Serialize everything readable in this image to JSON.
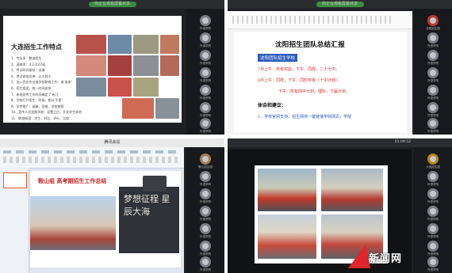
{
  "q1": {
    "title": "你正在观看屏幕共享",
    "slide_title": "大连招生工作特点",
    "points": [
      "1、专业多：数或招生",
      "2、录取率：4.2-4.07高",
      "3、考试时间紧张：选课",
      "4、考试参加名单：从大到小",
      "5、加入优化专业或学校联络工作：或'谁来'",
      "6、招生组团，统一时间安排",
      "7、参加宣传工作时间确定了'有几'",
      "8、学校打开招生，时候，都计'不是'",
      "9、宣传推广：或精，宣推、学校推荐",
      "10、宣传人员宣推学校：设置之后，开发学生体验",
      "11、联谊新团：学生、对比、评价、比较"
    ]
  },
  "q2": {
    "title": "你正在观看屏幕共享",
    "doc_heading": "沈阳招生团队总结汇报",
    "group_label": "沈阳团队招生学校",
    "lines": [
      "7月上午：所有实验，下午：同样，二十七中。",
      "8月上午：同样，下午：同时学校（十中计划）。",
      "下午：所有四中计划，理科，下届计划。",
      "体会和建议：",
      "1、学校官网支持，招生网将一键链接学院网页，学院"
    ]
  },
  "q3": {
    "title": "腾讯会议",
    "slide_title": "鞍山组 高考期招生工作总结",
    "banner_text": "梦想征程 星辰大海"
  },
  "q4": {
    "title": "",
    "watermark": "新闻网"
  },
  "side_q1": [
    "外语学院",
    "外语学院",
    "外语学院",
    "外语学院",
    "外语学院",
    "外语学院",
    "外语学院"
  ],
  "side_q2": [
    "沈阳招生团",
    "外语学院",
    "外语学院",
    "外语学院",
    "外语学院",
    "外语学院",
    "外语学院"
  ],
  "side_q3": [
    "鞍山招生团",
    "外语学院",
    "外语学院",
    "外语学院",
    "外语学院",
    "外语学院",
    "外语学院"
  ],
  "side_q4": [
    "大连招生团",
    "外语学院",
    "外语学院",
    "外语学院",
    "外语学院",
    "外语学院",
    "外语学院"
  ],
  "colors": {
    "accent_red": "#e0262a",
    "doc_blue": "#2b5bbf",
    "meeting_green": "#3a8d3f"
  },
  "clock": "01:09:52"
}
